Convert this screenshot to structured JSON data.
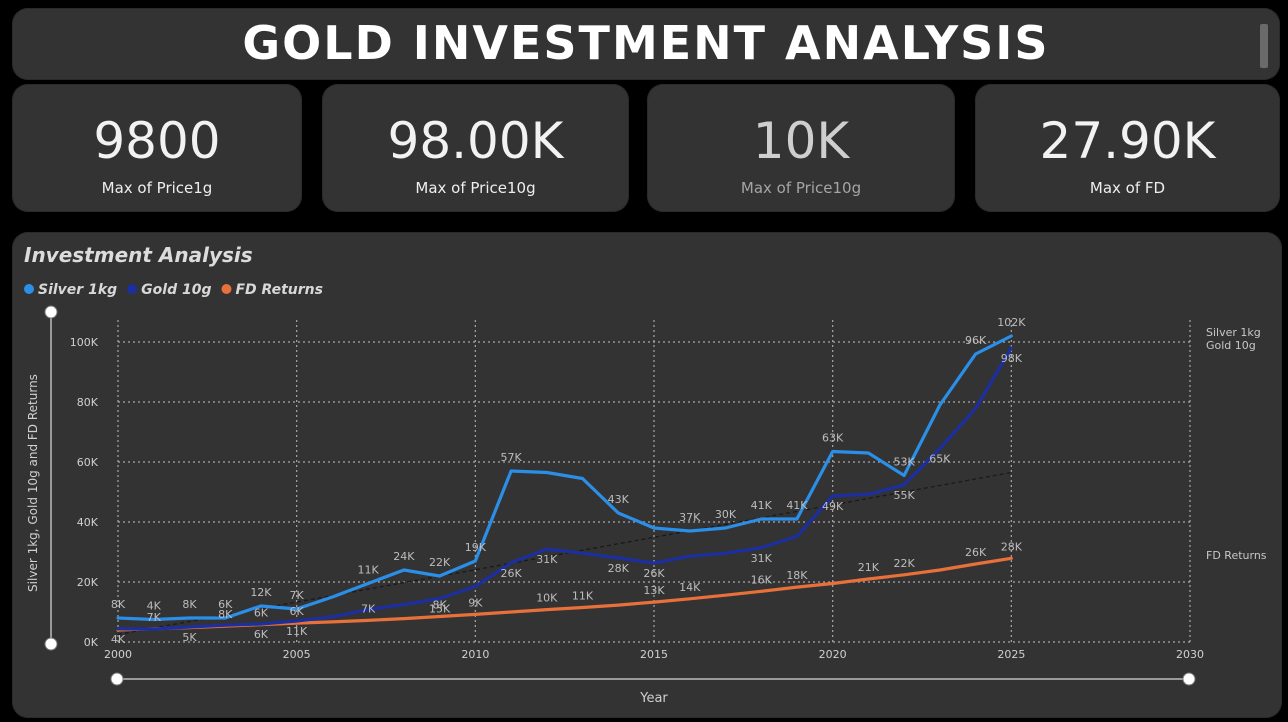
{
  "header": {
    "title": "GOLD INVESTMENT ANALYSIS"
  },
  "kpis": [
    {
      "value": "9800",
      "label": "Max of Price1g"
    },
    {
      "value": "98.00K",
      "label": "Max of Price10g"
    },
    {
      "value": "10K",
      "label": "Max of Price10g"
    },
    {
      "value": "27.90K",
      "label": "Max of FD"
    }
  ],
  "chart_data": {
    "type": "line",
    "title": "Investment Analysis",
    "xlabel": "Year",
    "ylabel": "Silver 1kg, Gold 10g and FD Returns",
    "xlim": [
      2000,
      2030
    ],
    "ylim": [
      0,
      100000
    ],
    "x_ticks": [
      "2000",
      "2005",
      "2010",
      "2015",
      "2020",
      "2025",
      "2030"
    ],
    "y_ticks": [
      "0K",
      "20K",
      "40K",
      "60K",
      "80K",
      "100K"
    ],
    "grid": true,
    "legend_position": "top-left",
    "x": [
      2000,
      2001,
      2002,
      2003,
      2004,
      2005,
      2006,
      2007,
      2008,
      2009,
      2010,
      2011,
      2012,
      2013,
      2014,
      2015,
      2016,
      2017,
      2018,
      2019,
      2020,
      2021,
      2022,
      2023,
      2024,
      2025
    ],
    "series": [
      {
        "name": "Silver 1kg",
        "color": "#2b8fe8",
        "end_label": "Silver 1kg",
        "values": [
          8000,
          7500,
          8000,
          8000,
          12000,
          11000,
          15000,
          19500,
          24000,
          22000,
          27000,
          57000,
          56500,
          54500,
          43000,
          38000,
          37000,
          38000,
          41000,
          41000,
          63500,
          63000,
          55500,
          79000,
          96000,
          102000
        ],
        "labels": [
          "8K",
          "4K",
          "8K",
          "6K",
          "12K",
          "7K",
          "",
          "11K",
          "24K",
          "22K",
          "19K",
          "57K",
          "",
          "",
          "43K",
          "",
          "37K",
          "30K",
          "41K",
          "41K",
          "63K",
          "",
          "53K",
          "",
          "96K",
          "102K"
        ]
      },
      {
        "name": "Gold 10g",
        "color": "#1c2fa0",
        "end_label": "Gold 10g",
        "values": [
          4400,
          4300,
          5000,
          5600,
          6000,
          7000,
          8400,
          10800,
          12500,
          14500,
          18500,
          26400,
          31000,
          29600,
          28000,
          26300,
          28600,
          29600,
          31400,
          35200,
          48700,
          49200,
          52400,
          64500,
          77800,
          98000
        ],
        "labels": [
          "4K",
          "",
          "5K",
          "",
          "6K",
          "11K",
          "",
          "",
          "",
          "15K",
          "",
          "26K",
          "31K",
          "",
          "28K",
          "26K",
          "",
          "",
          "31K",
          "",
          "49K",
          "",
          "55K",
          "65K",
          "",
          "98K"
        ]
      },
      {
        "name": "FD Returns",
        "color": "#e8703a",
        "end_label": "FD Returns",
        "values": [
          4000,
          4400,
          4800,
          5300,
          5800,
          6300,
          6700,
          7200,
          7800,
          8500,
          9200,
          10000,
          10800,
          11500,
          12300,
          13300,
          14400,
          15600,
          16900,
          18300,
          19500,
          21000,
          22400,
          24000,
          26000,
          27900
        ],
        "labels": [
          "",
          "7K",
          "",
          "8K",
          "6K",
          "6K",
          "",
          "7K",
          "",
          "8K",
          "9K",
          "",
          "10K",
          "11K",
          "",
          "13K",
          "14K",
          "",
          "16K",
          "18K",
          "",
          "21K",
          "22K",
          "",
          "26K",
          "28K"
        ]
      }
    ],
    "trend": {
      "name": "Trend",
      "x": [
        2000,
        2025
      ],
      "values": [
        2500,
        56500
      ]
    }
  }
}
